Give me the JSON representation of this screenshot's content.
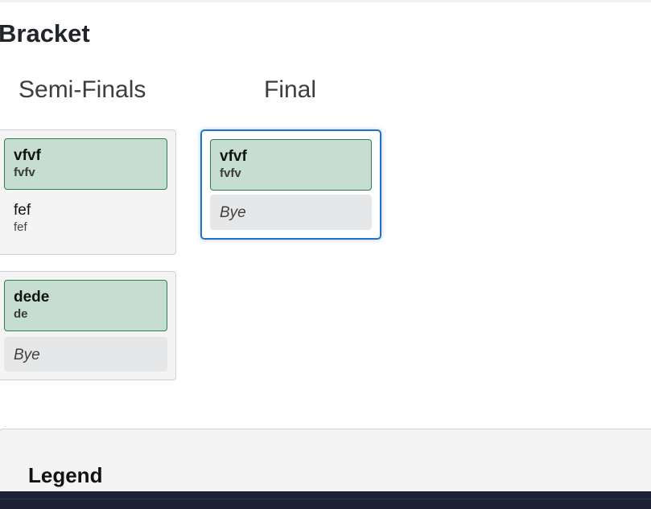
{
  "page": {
    "title": "Bracket"
  },
  "rounds": [
    {
      "title": "Semi-Finals",
      "matches": [
        {
          "slots": [
            {
              "type": "winner",
              "name": "vfvf",
              "sub": "fvfv"
            },
            {
              "type": "plain",
              "name": "fef",
              "sub": "fef"
            }
          ]
        },
        {
          "slots": [
            {
              "type": "winner",
              "name": "dede",
              "sub": "de"
            },
            {
              "type": "bye",
              "name": "Bye"
            }
          ]
        }
      ]
    },
    {
      "title": "Final",
      "matches": [
        {
          "highlighted": true,
          "slots": [
            {
              "type": "winner",
              "name": "vfvf",
              "sub": "fvfv"
            },
            {
              "type": "bye",
              "name": "Bye"
            }
          ]
        }
      ]
    }
  ],
  "legend": {
    "title": "Legend"
  },
  "colors": {
    "winner_bg": "#c6ded2",
    "winner_border": "#2e7d4d",
    "highlight_border": "#1e73c6",
    "bye_bg": "#e6e7e8",
    "footer_bar": "#1c2233"
  }
}
